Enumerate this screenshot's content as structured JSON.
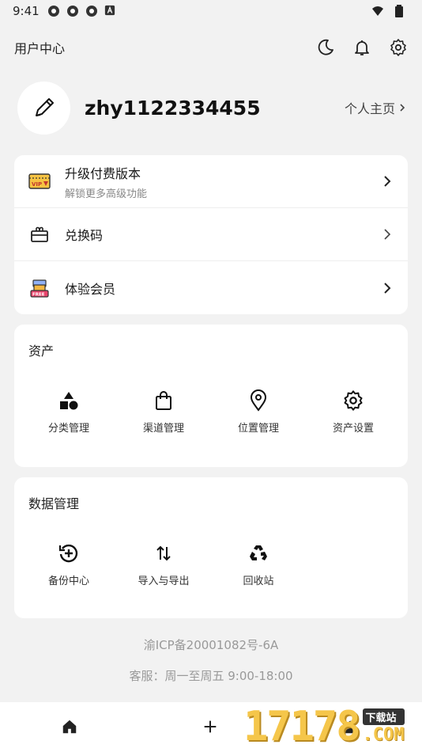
{
  "status": {
    "time": "9:41"
  },
  "header": {
    "title": "用户中心"
  },
  "profile": {
    "username": "zhy1122334455",
    "homepage_label": "个人主页"
  },
  "menu": [
    {
      "label": "升级付费版本",
      "sub": "解锁更多高级功能"
    },
    {
      "label": "兑换码"
    },
    {
      "label": "体验会员"
    }
  ],
  "assets": {
    "title": "资产",
    "items": [
      {
        "label": "分类管理",
        "icon": "shapes-icon"
      },
      {
        "label": "渠道管理",
        "icon": "bag-icon"
      },
      {
        "label": "位置管理",
        "icon": "location-pin-icon"
      },
      {
        "label": "资产设置",
        "icon": "gear-icon"
      }
    ]
  },
  "data_mgmt": {
    "title": "数据管理",
    "items": [
      {
        "label": "备份中心",
        "icon": "backup-icon"
      },
      {
        "label": "导入与导出",
        "icon": "import-export-icon"
      },
      {
        "label": "回收站",
        "icon": "recycle-icon"
      }
    ]
  },
  "footer": {
    "icp": "渝ICP备20001082号-6A",
    "service": "客服：周一至周五 9:00-18:00"
  },
  "watermark": {
    "num": "17178",
    "top": "下载站",
    "bottom": ".COM"
  }
}
